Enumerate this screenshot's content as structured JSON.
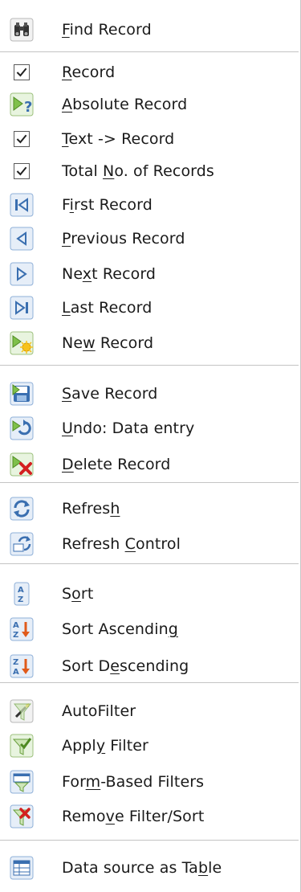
{
  "menu": {
    "items": [
      {
        "label": "Find Record",
        "mnemonic": 0,
        "icon": "binoculars-icon",
        "kind": "icon"
      },
      {
        "label": "Record",
        "mnemonic": 0,
        "icon": "checkmark-icon",
        "kind": "check",
        "checked": true
      },
      {
        "label": "Absolute Record",
        "mnemonic": 0,
        "icon": "goto-record-icon",
        "kind": "icon"
      },
      {
        "label": "Text -> Record",
        "mnemonic": 0,
        "icon": "checkmark-icon",
        "kind": "check",
        "checked": true
      },
      {
        "label": "Total No. of Records",
        "mnemonic": 6,
        "icon": "checkmark-icon",
        "kind": "check",
        "checked": true
      },
      {
        "label": "First Record",
        "mnemonic": 1,
        "icon": "first-record-icon",
        "kind": "icon"
      },
      {
        "label": "Previous Record",
        "mnemonic": 0,
        "icon": "previous-record-icon",
        "kind": "icon"
      },
      {
        "label": "Next Record",
        "mnemonic": 2,
        "icon": "next-record-icon",
        "kind": "icon"
      },
      {
        "label": "Last Record",
        "mnemonic": 0,
        "icon": "last-record-icon",
        "kind": "icon"
      },
      {
        "label": "New Record",
        "mnemonic": 2,
        "icon": "new-record-icon",
        "kind": "icon"
      },
      {
        "label": "Save Record",
        "mnemonic": 0,
        "icon": "save-record-icon",
        "kind": "icon"
      },
      {
        "label": "Undo: Data entry",
        "mnemonic": 0,
        "icon": "undo-record-icon",
        "kind": "icon"
      },
      {
        "label": "Delete Record",
        "mnemonic": 0,
        "icon": "delete-record-icon",
        "kind": "icon"
      },
      {
        "label": "Refresh",
        "mnemonic": 6,
        "icon": "refresh-icon",
        "kind": "icon"
      },
      {
        "label": "Refresh Control",
        "mnemonic": 8,
        "icon": "refresh-control-icon",
        "kind": "icon"
      },
      {
        "label": "Sort",
        "mnemonic": 1,
        "icon": "sort-icon",
        "kind": "icon"
      },
      {
        "label": "Sort Ascending",
        "mnemonic": 13,
        "icon": "sort-ascending-icon",
        "kind": "icon"
      },
      {
        "label": "Sort Descending",
        "mnemonic": 6,
        "icon": "sort-descending-icon",
        "kind": "icon"
      },
      {
        "label": "AutoFilter",
        "mnemonic": -1,
        "icon": "autofilter-icon",
        "kind": "icon"
      },
      {
        "label": "Apply Filter",
        "mnemonic": 4,
        "icon": "apply-filter-icon",
        "kind": "icon"
      },
      {
        "label": "Form-Based Filters",
        "mnemonic": 3,
        "icon": "form-filter-icon",
        "kind": "icon"
      },
      {
        "label": "Remove Filter/Sort",
        "mnemonic": 4,
        "icon": "remove-filter-icon",
        "kind": "icon"
      },
      {
        "label": "Data source as Table",
        "mnemonic": 17,
        "icon": "datasource-table-icon",
        "kind": "icon"
      }
    ]
  },
  "colors": {
    "icon_blue": "#4a7fc0",
    "icon_green": "#5aa02c",
    "icon_red": "#d42020",
    "separator": "#c4c4c4"
  }
}
